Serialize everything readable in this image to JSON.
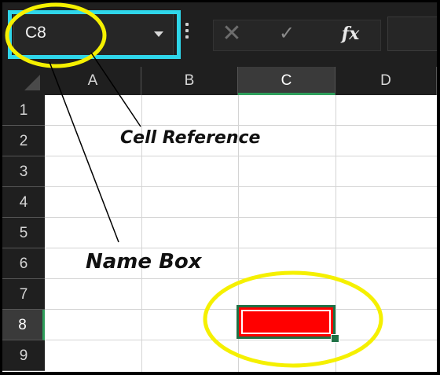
{
  "formula_bar": {
    "name_box_value": "C8",
    "cancel_icon": "✕",
    "enter_icon": "✓",
    "fx_label": "fx"
  },
  "sheet": {
    "columns": [
      "A",
      "B",
      "C",
      "D"
    ],
    "rows": [
      "1",
      "2",
      "3",
      "4",
      "5",
      "6",
      "7",
      "8",
      "9"
    ],
    "selected_cell": "C8",
    "selected_cell_fill": "#ff0000",
    "selection_color": "#1e7145"
  },
  "annotations": {
    "cell_reference": "Cell Reference",
    "name_box": "Name Box",
    "highlight_box_color": "#2fd6ea",
    "ellipse_color": "#f5f000"
  }
}
